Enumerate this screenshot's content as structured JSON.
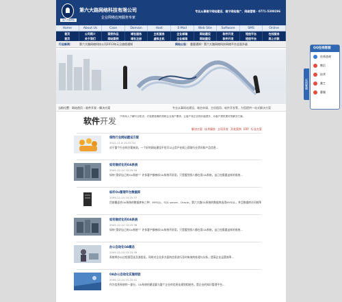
{
  "header": {
    "logo_text": "第六大路网络",
    "company": "第六大路网络科技有限公司",
    "slogan": "企业网络应用服务专家",
    "hotline": "专业从事南宁网站建设、南宁网站推广、网络营销 · 0771-5300296"
  },
  "topnav": [
    "Home",
    "About Us",
    "Case",
    "Domain",
    "Host",
    "E-Mail",
    "Web Site",
    "Software",
    "SMS",
    "Online"
  ],
  "mainnav": {
    "row1": [
      "首页",
      "公司简介",
      "案例作品",
      "域名服务",
      "主机服务",
      "企业邮箱",
      "网站建设",
      "软件开发",
      "短信平台",
      "在线服务"
    ],
    "row2": [
      "首页",
      "关于我们",
      "网站案例",
      "域名注册",
      "虚拟主机",
      "企业邮局",
      "网站建设",
      "软件开发",
      "短信平台",
      "网上付款"
    ]
  },
  "newsbar": {
    "tag1": "行业新闻：",
    "text1": "第六大路网络科技公司2013年元旦放假通知",
    "tag2": "网站公告：",
    "text2": "重要通知！第六大路网络科技网络平台全面升级"
  },
  "breadcrumb": {
    "home": "当前位置：网站首页 › 软件开发 › 解决方案",
    "desc": "专业从事网站建设、域名申请、主机租用、软件开发等，为您提供一站式解决方案"
  },
  "section": {
    "title_main": "软件",
    "title_thin": "开发",
    "desc": "只有深入了解行业知识，才能更准确的洞悉企业用户需求，让客户真正实现价值提升，为客户提供更好的解决方案。"
  },
  "tabs": [
    "解决方案",
    "技术服务",
    "立项开发",
    "开发案例",
    "ERP",
    "行业方案"
  ],
  "articles": [
    {
      "title": "保险行业网站建设方案",
      "date": "2012-11-8 15:25:34",
      "text": "对于整个行业的方案来说，一个好的网站建设不但可以让用户在网上获取行业资讯和产品信息..."
    },
    {
      "title": "如何做优化的OA系统",
      "date": "2009-12-14 15:29:16",
      "text": "如何“用好自己的OA系统”？许多客户都感叹OA系统不好用，只是看到别人都在用OA系统，自己也需要这样的系统..."
    },
    {
      "title": "标杆Oa管理平台数据库",
      "date": "2009-12-14 15:25:37",
      "text": "目前最适合OA系统的数据库有三种：MYSQL、SQL server、Oracle，第六大路OA系统的数据库选用MYSQL，并且数据库访问效率高..."
    },
    {
      "title": "如何做优化的OA系统",
      "date": "2009-12-14 15:25:38",
      "text": "如何“用好自己的OA系统”？许多客户都感叹OA系统不好用，只是看到别人都在用OA系统，自己也需要这样的系统..."
    },
    {
      "title": "办公自动化OA概念",
      "date": "2009-12-14 15:25:39",
      "text": "系统将办公过程规范化及流程化，同时对企业多方面的信息进行及时有效的处理与分析，提高企业运营效率..."
    },
    {
      "title": "OA办公自动化实施经验",
      "date": "2009-12-14 15:25:41",
      "text": "作为信息系统的一部分，OA系统的建设要与整个企业的信息化规划相结合，是企业的知识管理平台..."
    }
  ],
  "qq": {
    "title": "QQ在线客服",
    "tab_label": "在线客服",
    "items": [
      "在线咨询",
      "售后",
      "技术",
      "美工",
      "客服"
    ]
  },
  "colors": {
    "brand": "#1a3f7d",
    "accent_red": "#c0392b"
  }
}
